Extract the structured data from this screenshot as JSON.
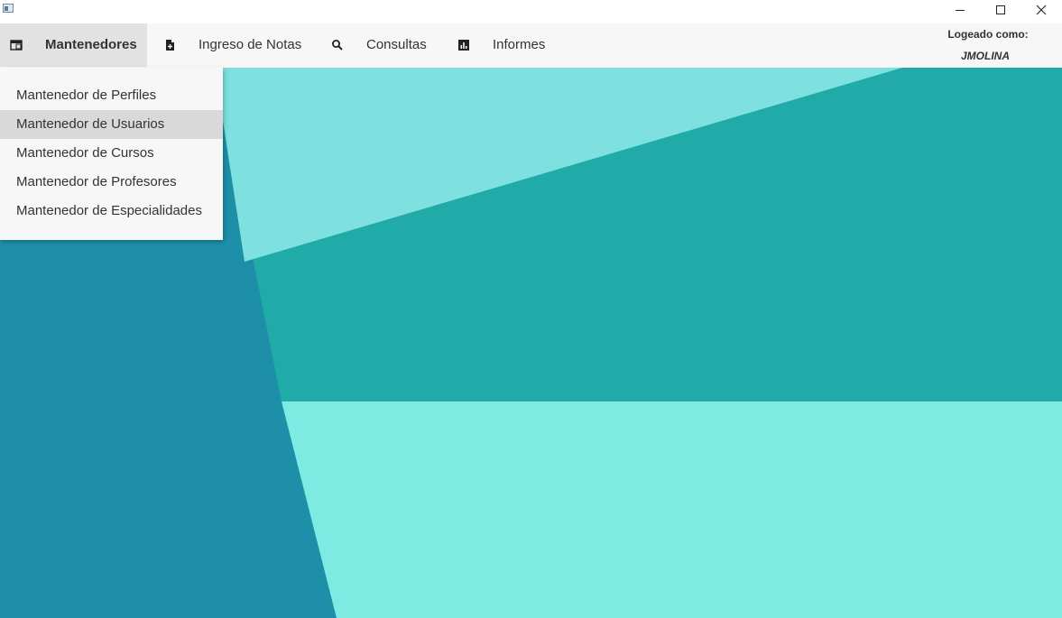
{
  "window": {
    "controls": [
      {
        "name": "minimize-icon",
        "title": "Minimizar"
      },
      {
        "name": "maximize-icon",
        "title": "Maximizar"
      },
      {
        "name": "close-icon",
        "title": "Cerrar"
      }
    ]
  },
  "menubar": {
    "items": [
      {
        "label": "Mantenedores",
        "icon": "folder-window-icon",
        "active": true
      },
      {
        "label": "Ingreso de Notas",
        "icon": "file-add-icon",
        "active": false
      },
      {
        "label": "Consultas",
        "icon": "search-icon",
        "active": false
      },
      {
        "label": "Informes",
        "icon": "bar-chart-icon",
        "active": false
      }
    ]
  },
  "login": {
    "label": "Logeado como:",
    "user": "JMOLINA"
  },
  "dropdown": {
    "items": [
      {
        "label": "Mantenedor de Perfiles"
      },
      {
        "label": "Mantenedor de Usuarios",
        "hovered": true
      },
      {
        "label": "Mantenedor de Cursos"
      },
      {
        "label": "Mantenedor de Profesores"
      },
      {
        "label": "Mantenedor de Especialidades"
      }
    ]
  },
  "colors": {
    "menubar_bg": "#f7f7f7",
    "active_menu_bg": "#e2e2e2",
    "bg_dark_blue": "#1e8fa8",
    "bg_teal": "#20aba9",
    "bg_light_cyan": "#7ee0df",
    "bg_mint": "#7eebe3"
  }
}
